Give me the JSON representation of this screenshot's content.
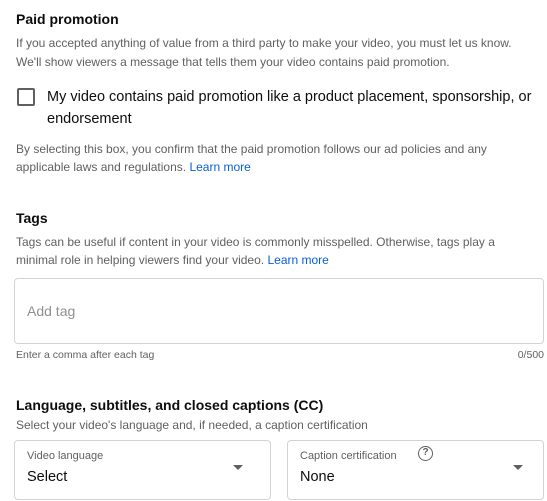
{
  "paid_promotion": {
    "title": "Paid promotion",
    "desc_line1": "If you accepted anything of value from a third party to make your video, you must let us know.",
    "desc_line2": "We'll show viewers a message that tells them your video contains paid promotion.",
    "checkbox_label_line1": "My video contains paid promotion like a product placement, sponsorship, or",
    "checkbox_label_line2": "endorsement",
    "checkbox_checked": false,
    "confirm_line1": "By selecting this box, you confirm that the paid promotion follows our ad policies and any",
    "confirm_line2": "applicable laws and regulations.",
    "learn_more": "Learn more"
  },
  "tags": {
    "title": "Tags",
    "desc_line1": "Tags can be useful if content in your video is commonly misspelled. Otherwise, tags play a",
    "desc_line2": "minimal role in helping viewers find your video.",
    "learn_more": "Learn more",
    "input_placeholder": "Add tag",
    "input_value": "",
    "hint": "Enter a comma after each tag",
    "counter": "0/500"
  },
  "language": {
    "title": "Language, subtitles, and closed captions (CC)",
    "desc": "Select your video's language and, if needed, a caption certification",
    "video_language": {
      "label": "Video language",
      "value": "Select"
    },
    "caption_certification": {
      "label": "Caption certification",
      "value": "None",
      "help_icon": "?"
    }
  },
  "colors": {
    "link": "#065fd4",
    "text": "#0d0d0d",
    "secondary": "#606060",
    "border": "#d3d3d3"
  }
}
